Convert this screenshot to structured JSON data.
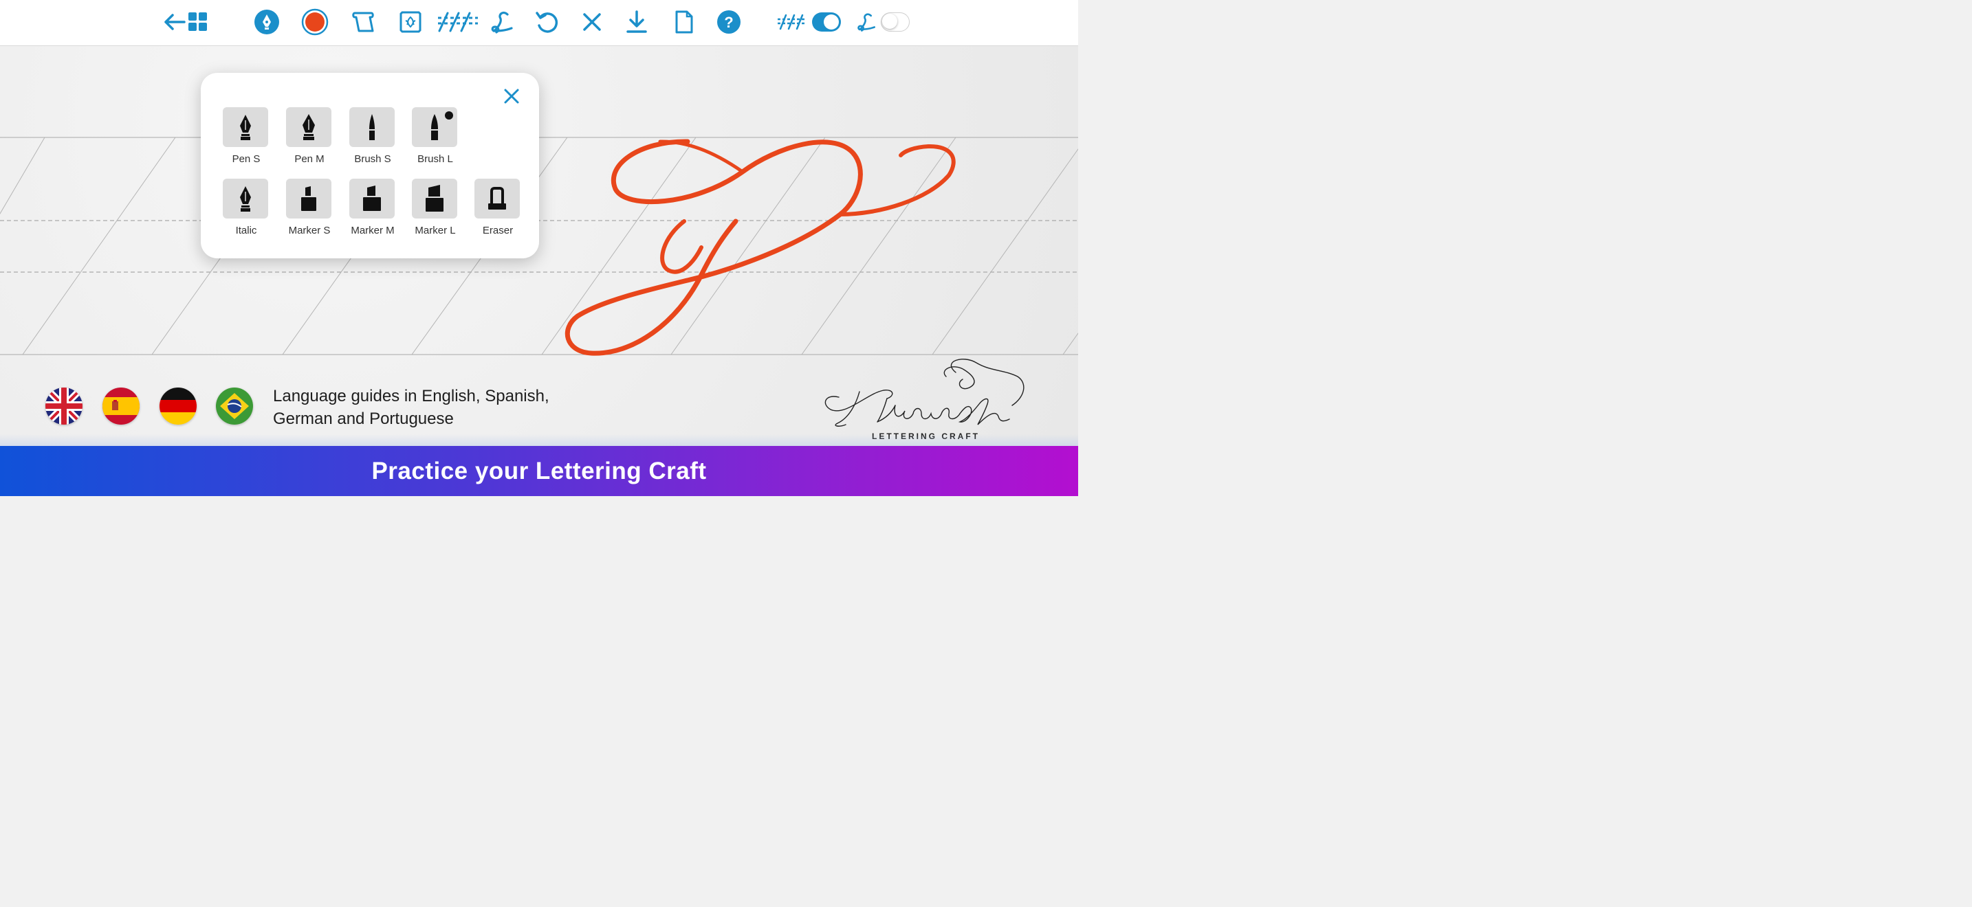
{
  "toolbar": {
    "icons": [
      "back-arrow-icon",
      "grid-icon",
      "pen-nib-icon",
      "color-swatch-icon",
      "paper-scroll-icon",
      "ornament-frame-icon",
      "guidelines-icon",
      "letter-guide-icon",
      "undo-icon",
      "clear-icon",
      "download-icon",
      "page-icon",
      "help-icon"
    ],
    "toggles": [
      {
        "name": "guidelines-toggle",
        "on": true
      },
      {
        "name": "letter-guide-toggle",
        "on": false
      }
    ],
    "accent": "#1b8fca",
    "current_color": "#e8461b"
  },
  "tools_panel": {
    "row1": [
      {
        "label": "Pen S",
        "icon": "pen-nib-icon"
      },
      {
        "label": "Pen M",
        "icon": "pen-nib-icon"
      },
      {
        "label": "Brush S",
        "icon": "brush-icon"
      },
      {
        "label": "Brush L",
        "icon": "brush-icon"
      }
    ],
    "row2": [
      {
        "label": "Italic",
        "icon": "italic-nib-icon"
      },
      {
        "label": "Marker S",
        "icon": "marker-icon"
      },
      {
        "label": "Marker M",
        "icon": "marker-icon"
      },
      {
        "label": "Marker L",
        "icon": "marker-icon"
      },
      {
        "label": "Eraser",
        "icon": "eraser-icon"
      }
    ]
  },
  "stroke_color": "#e8461b",
  "languages": {
    "flags": [
      "uk-flag-icon",
      "spain-flag-icon",
      "germany-flag-icon",
      "brazil-flag-icon"
    ],
    "line1": "Language guides in English, Spanish,",
    "line2": "German and Portuguese"
  },
  "logo": {
    "title": "Flourish",
    "subtitle": "LETTERING CRAFT"
  },
  "banner": {
    "text": "Practice your Lettering Craft",
    "gradient": [
      "#1052d9",
      "#b30fd0"
    ]
  }
}
